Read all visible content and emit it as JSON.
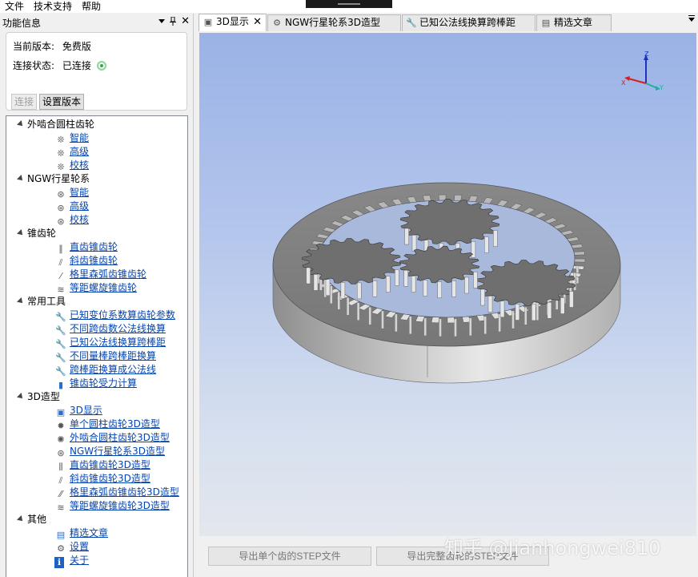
{
  "menu": [
    "文件",
    "技术支持",
    "帮助"
  ],
  "panel": {
    "title": "功能信息",
    "version_label": "当前版本:",
    "version_value": "免费版",
    "status_label": "连接状态:",
    "status_value": "已连接",
    "connect_button": "连接",
    "set_version_button": "设置版本",
    "pin_symbol": "ᵖ",
    "close_symbol": "✕"
  },
  "tree": [
    {
      "label": "外啮合圆柱齿轮",
      "items": [
        {
          "label": "智能",
          "icon": "gear-rack-icon"
        },
        {
          "label": "高级",
          "icon": "gear-rack-icon"
        },
        {
          "label": "校核",
          "icon": "gear-rack-icon"
        }
      ]
    },
    {
      "label": "NGW行星轮系",
      "items": [
        {
          "label": "智能",
          "icon": "planetary-icon"
        },
        {
          "label": "高级",
          "icon": "planetary-icon"
        },
        {
          "label": "校核",
          "icon": "planetary-icon"
        }
      ]
    },
    {
      "label": "锥齿轮",
      "items": [
        {
          "label": "直齿锥齿轮",
          "icon": "bevel-straight-icon"
        },
        {
          "label": "斜齿锥齿轮",
          "icon": "bevel-helical-icon"
        },
        {
          "label": "格里森弧齿锥齿轮",
          "icon": "bevel-spiral-icon"
        },
        {
          "label": "等距螺旋锥齿轮",
          "icon": "bevel-equidistant-icon"
        }
      ]
    },
    {
      "label": "常用工具",
      "items": [
        {
          "label": "已知变位系数算齿轮参数",
          "icon": "wrench-icon"
        },
        {
          "label": "不同跨齿数公法线换算",
          "icon": "wrench-icon"
        },
        {
          "label": "已知公法线换算跨棒距",
          "icon": "wrench-icon"
        },
        {
          "label": "不同量棒跨棒距换算",
          "icon": "wrench-icon"
        },
        {
          "label": "跨棒距换算成公法线",
          "icon": "wrench-icon"
        },
        {
          "label": "锥齿轮受力计算",
          "icon": "force-icon"
        }
      ]
    },
    {
      "label": "3D造型",
      "items": [
        {
          "label": "3D显示",
          "icon": "3d-view-icon"
        },
        {
          "label": "单个圆柱齿轮3D造型",
          "icon": "spur-gear-3d-icon"
        },
        {
          "label": "外啮合圆柱齿轮3D造型",
          "icon": "gear-pair-3d-icon"
        },
        {
          "label": "NGW行星轮系3D造型",
          "icon": "planetary-3d-icon"
        },
        {
          "label": "直齿锥齿轮3D造型",
          "icon": "bevel-straight-3d-icon"
        },
        {
          "label": "斜齿锥齿轮3D造型",
          "icon": "bevel-helical-3d-icon"
        },
        {
          "label": "格里森弧齿锥齿轮3D造型",
          "icon": "bevel-spiral-3d-icon"
        },
        {
          "label": "等距螺旋锥齿轮3D造型",
          "icon": "bevel-equidistant-3d-icon"
        }
      ]
    },
    {
      "label": "其他",
      "items": [
        {
          "label": "精选文章",
          "icon": "article-icon"
        },
        {
          "label": "设置",
          "icon": "gear-icon"
        },
        {
          "label": "关于",
          "icon": "info-icon"
        }
      ]
    }
  ],
  "tabs": [
    {
      "label": "3D显示",
      "icon": "3d-view-icon",
      "active": true
    },
    {
      "label": "NGW行星轮系3D造型",
      "icon": "planetary-3d-icon",
      "active": false
    },
    {
      "label": "已知公法线换算跨棒距",
      "icon": "wrench-icon",
      "active": false
    },
    {
      "label": "精选文章",
      "icon": "article-icon",
      "active": false
    }
  ],
  "viewport": {
    "axes": {
      "z": "Z",
      "x": "X",
      "y": "Y"
    },
    "colors": {
      "x": "#d42020",
      "y": "#20b0a0",
      "z": "#2030c0"
    }
  },
  "bottom": {
    "export_single": "导出单个齿的STEP文件",
    "export_full": "导出完整齿轮的STEP文件"
  },
  "watermark": "知乎 @Jianhongwei810"
}
